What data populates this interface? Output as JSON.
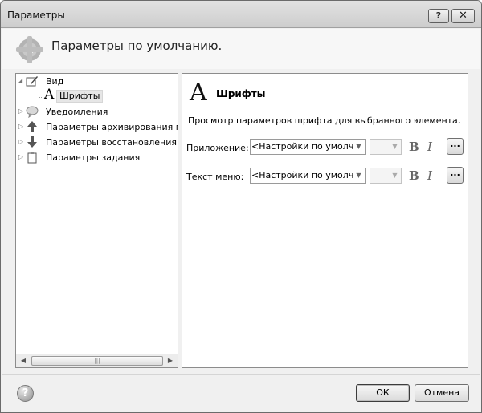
{
  "window": {
    "title": "Параметры",
    "help_label": "?",
    "close_label": "✕"
  },
  "header": {
    "title": "Параметры по умолчанию.",
    "icon": "gear-icon"
  },
  "tree": {
    "items": [
      {
        "label": "Вид",
        "icon": "view-icon",
        "expanded": true
      },
      {
        "label": "Шрифты",
        "icon": "font-a-icon",
        "selected": true,
        "glyph": "A"
      },
      {
        "label": "Уведомления",
        "icon": "notification-icon"
      },
      {
        "label": "Параметры архивирования по у",
        "icon": "backup-icon"
      },
      {
        "label": "Параметры восстановления по у",
        "icon": "restore-icon"
      },
      {
        "label": "Параметры задания",
        "icon": "task-icon"
      }
    ],
    "scroll_thumb_grip": "|||"
  },
  "panel": {
    "glyph": "A",
    "title": "Шрифты",
    "description": "Просмотр параметров шрифта для выбранного элемента.",
    "rows": [
      {
        "label": "Приложение:",
        "font": "<Настройки по умолчанию>",
        "size": "",
        "bold": "B",
        "italic": "I",
        "more": "..."
      },
      {
        "label": "Текст меню:",
        "font": "<Настройки по умолчанию>",
        "size": "",
        "bold": "B",
        "italic": "I",
        "more": "..."
      }
    ]
  },
  "footer": {
    "help_label": "?",
    "ok_label": "ОК",
    "cancel_label": "Отмена"
  }
}
